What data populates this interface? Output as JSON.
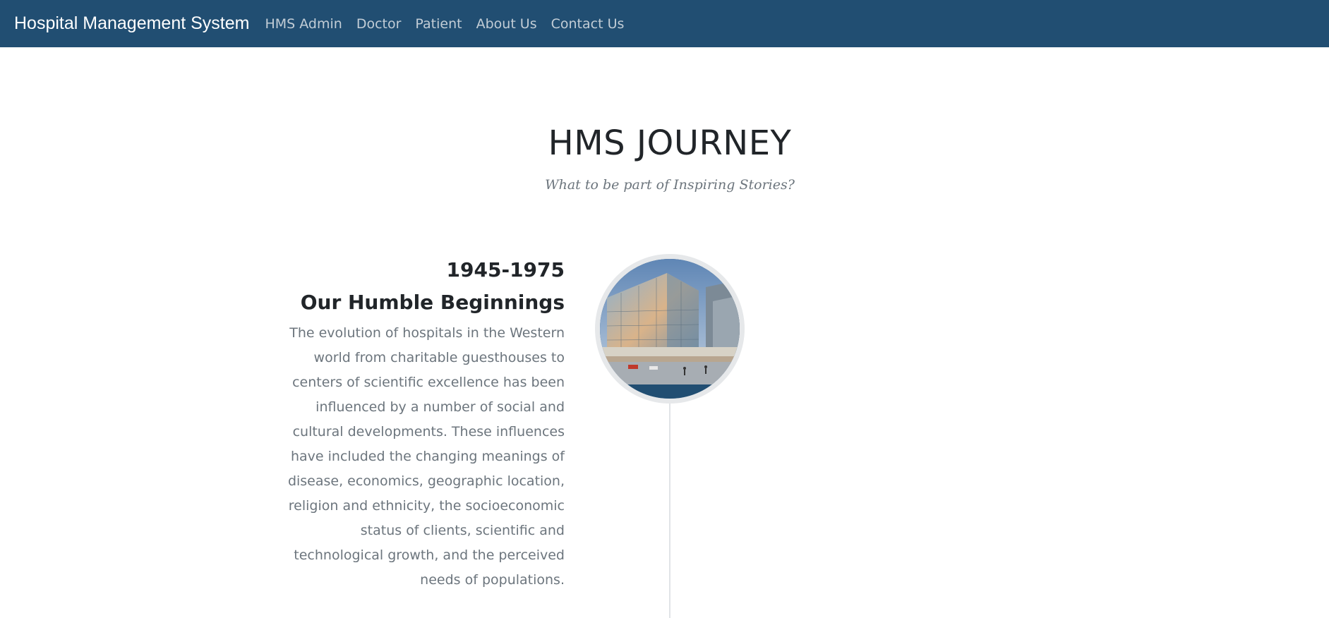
{
  "navbar": {
    "brand": "Hospital Management System",
    "links": [
      "HMS Admin",
      "Doctor",
      "Patient",
      "About Us",
      "Contact Us"
    ]
  },
  "section": {
    "title": "HMS JOURNEY",
    "subtitle": "What to be part of Inspiring Stories?"
  },
  "timeline": [
    {
      "year": "1945-1975",
      "heading": "Our Humble Beginnings",
      "image": "hospital-building-photo",
      "body": "The evolution of hospitals in the Western world from charitable guesthouses to centers of scientific excellence has been influenced by a number of social and cultural developments. These influences have included the changing meanings of disease, economics, geographic location, religion and ethnicity, the socioeconomic status of clients, scientific and technological growth, and the perceived needs of populations."
    }
  ],
  "colors": {
    "navbar_bg": "#214e72",
    "nav_link": "#c2cdd6",
    "heading": "#212529",
    "muted": "#6c757d"
  }
}
